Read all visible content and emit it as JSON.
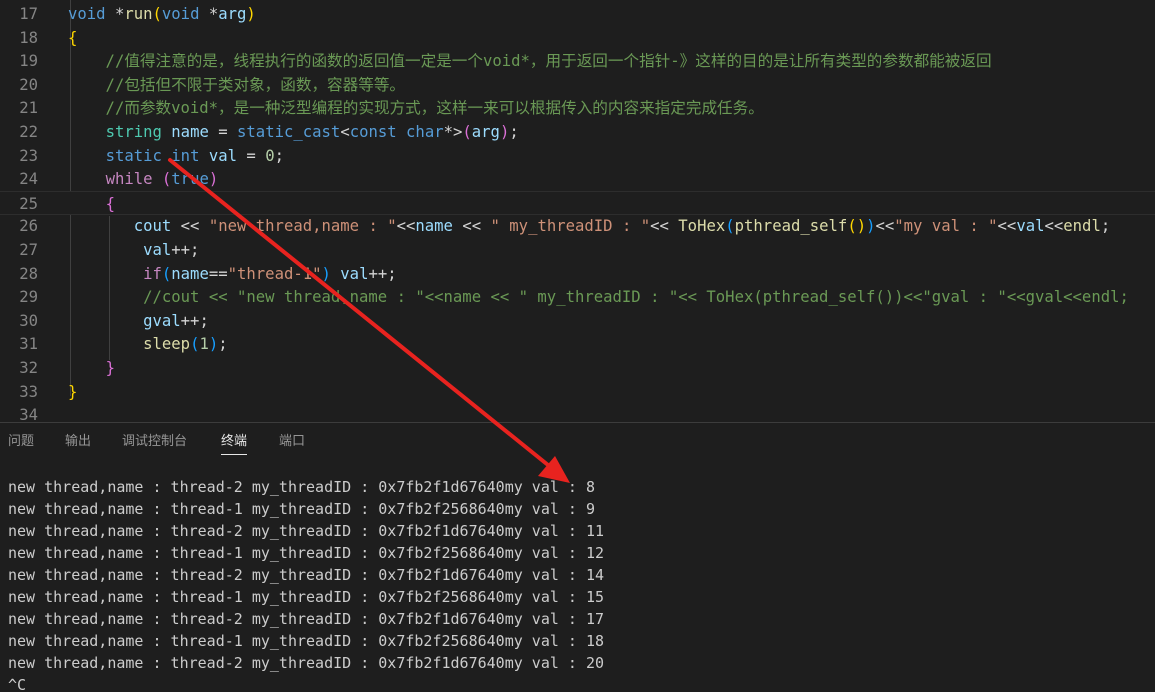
{
  "editor": {
    "lines": [
      {
        "num": "17",
        "tokens": [
          [
            "void",
            "t-kw"
          ],
          [
            " *",
            "t-txt"
          ],
          [
            "run",
            "t-fn"
          ],
          [
            "(",
            "t-b1"
          ],
          [
            "void",
            "t-kw"
          ],
          [
            " *",
            "t-txt"
          ],
          [
            "arg",
            "t-var"
          ],
          [
            ")",
            "t-b1"
          ]
        ]
      },
      {
        "num": "18",
        "tokens": [
          [
            "{",
            "t-b1"
          ]
        ]
      },
      {
        "num": "19",
        "tokens": [
          [
            "    //值得注意的是，线程执行的函数的返回值一定是一个void*，用于返回一个指针-》这样的目的是让所有类型的参数都能被返回",
            "t-cmt"
          ]
        ]
      },
      {
        "num": "20",
        "tokens": [
          [
            "    //包括但不限于类对象，函数，容器等等。",
            "t-cmt"
          ]
        ]
      },
      {
        "num": "21",
        "tokens": [
          [
            "    //而参数void*，是一种泛型编程的实现方式，这样一来可以根据传入的内容来指定完成任务。",
            "t-cmt"
          ]
        ]
      },
      {
        "num": "22",
        "tokens": [
          [
            "    ",
            "t-txt"
          ],
          [
            "string",
            "t-ns"
          ],
          [
            " ",
            "t-txt"
          ],
          [
            "name",
            "t-var"
          ],
          [
            " = ",
            "t-txt"
          ],
          [
            "static_cast",
            "t-kw"
          ],
          [
            "<",
            "t-txt"
          ],
          [
            "const",
            "t-kw"
          ],
          [
            " ",
            "t-txt"
          ],
          [
            "char",
            "t-kw"
          ],
          [
            "*>",
            "t-txt"
          ],
          [
            "(",
            "t-b2"
          ],
          [
            "arg",
            "t-var"
          ],
          [
            ")",
            "t-b2"
          ],
          [
            ";",
            "t-txt"
          ]
        ]
      },
      {
        "num": "23",
        "tokens": [
          [
            "    ",
            "t-txt"
          ],
          [
            "static",
            "t-kw"
          ],
          [
            " ",
            "t-txt"
          ],
          [
            "int",
            "t-kw"
          ],
          [
            " ",
            "t-txt"
          ],
          [
            "val",
            "t-var"
          ],
          [
            " = ",
            "t-txt"
          ],
          [
            "0",
            "t-num"
          ],
          [
            ";",
            "t-txt"
          ]
        ]
      },
      {
        "num": "24",
        "tokens": [
          [
            "    ",
            "t-txt"
          ],
          [
            "while",
            "t-ctl"
          ],
          [
            " ",
            "t-txt"
          ],
          [
            "(",
            "t-b2"
          ],
          [
            "true",
            "t-kw"
          ],
          [
            ")",
            "t-b2"
          ]
        ]
      },
      {
        "num": "25",
        "tokens": [
          [
            "    ",
            "t-txt"
          ],
          [
            "{",
            "t-b2"
          ]
        ]
      },
      {
        "num": "26",
        "tokens": [
          [
            "       ",
            "t-txt"
          ],
          [
            "cout",
            "t-var"
          ],
          [
            " << ",
            "t-txt"
          ],
          [
            "\"new thread,name : \"",
            "t-str"
          ],
          [
            "<<",
            "t-txt"
          ],
          [
            "name",
            "t-var"
          ],
          [
            " << ",
            "t-txt"
          ],
          [
            "\" my_threadID : \"",
            "t-str"
          ],
          [
            "<< ",
            "t-txt"
          ],
          [
            "ToHex",
            "t-fn"
          ],
          [
            "(",
            "t-b3"
          ],
          [
            "pthread_self",
            "t-fn"
          ],
          [
            "()",
            "t-b1"
          ],
          [
            ")",
            "t-b3"
          ],
          [
            "<<",
            "t-txt"
          ],
          [
            "\"my val : \"",
            "t-str"
          ],
          [
            "<<",
            "t-txt"
          ],
          [
            "val",
            "t-var"
          ],
          [
            "<<",
            "t-txt"
          ],
          [
            "endl",
            "t-fn"
          ],
          [
            ";",
            "t-txt"
          ]
        ]
      },
      {
        "num": "27",
        "tokens": [
          [
            "        ",
            "t-txt"
          ],
          [
            "val",
            "t-var"
          ],
          [
            "++;",
            "t-txt"
          ]
        ]
      },
      {
        "num": "28",
        "tokens": [
          [
            "        ",
            "t-txt"
          ],
          [
            "if",
            "t-ctl"
          ],
          [
            "(",
            "t-b3"
          ],
          [
            "name",
            "t-var"
          ],
          [
            "==",
            "t-txt"
          ],
          [
            "\"thread-1\"",
            "t-str"
          ],
          [
            ")",
            "t-b3"
          ],
          [
            " ",
            "t-txt"
          ],
          [
            "val",
            "t-var"
          ],
          [
            "++;",
            "t-txt"
          ]
        ]
      },
      {
        "num": "29",
        "tokens": [
          [
            "        //cout << \"new thread,name : \"<<name << \" my_threadID : \"<< ToHex(pthread_self())<<\"gval : \"<<gval<<endl;",
            "t-cmt"
          ]
        ]
      },
      {
        "num": "30",
        "tokens": [
          [
            "        ",
            "t-txt"
          ],
          [
            "gval",
            "t-var"
          ],
          [
            "++;",
            "t-txt"
          ]
        ]
      },
      {
        "num": "31",
        "tokens": [
          [
            "        ",
            "t-txt"
          ],
          [
            "sleep",
            "t-fn"
          ],
          [
            "(",
            "t-b3"
          ],
          [
            "1",
            "t-num"
          ],
          [
            ")",
            "t-b3"
          ],
          [
            ";",
            "t-txt"
          ]
        ]
      },
      {
        "num": "32",
        "tokens": [
          [
            "    ",
            "t-txt"
          ],
          [
            "}",
            "t-b2"
          ]
        ]
      },
      {
        "num": "33",
        "tokens": [
          [
            "}",
            "t-b1"
          ]
        ]
      },
      {
        "num": "34",
        "tokens": []
      }
    ]
  },
  "panel": {
    "tabs": [
      {
        "label": "问题",
        "active": false
      },
      {
        "label": "输出",
        "active": false
      },
      {
        "label": "调试控制台",
        "active": false
      },
      {
        "label": "终端",
        "active": true
      },
      {
        "label": "端口",
        "active": false
      }
    ]
  },
  "terminal": {
    "lines": [
      "new thread,name : thread-2 my_threadID : 0x7fb2f1d67640my val : 8",
      "new thread,name : thread-1 my_threadID : 0x7fb2f2568640my val : 9",
      "new thread,name : thread-2 my_threadID : 0x7fb2f1d67640my val : 11",
      "new thread,name : thread-1 my_threadID : 0x7fb2f2568640my val : 12",
      "new thread,name : thread-2 my_threadID : 0x7fb2f1d67640my val : 14",
      "new thread,name : thread-1 my_threadID : 0x7fb2f2568640my val : 15",
      "new thread,name : thread-2 my_threadID : 0x7fb2f1d67640my val : 17",
      "new thread,name : thread-1 my_threadID : 0x7fb2f2568640my val : 18",
      "new thread,name : thread-2 my_threadID : 0x7fb2f1d67640my val : 20",
      "^C"
    ]
  },
  "colors": {
    "background": "#1e1e1e",
    "annotation_arrow": "#e8231f",
    "comment": "#6a9955",
    "keyword": "#569cd6",
    "string": "#ce9178"
  }
}
